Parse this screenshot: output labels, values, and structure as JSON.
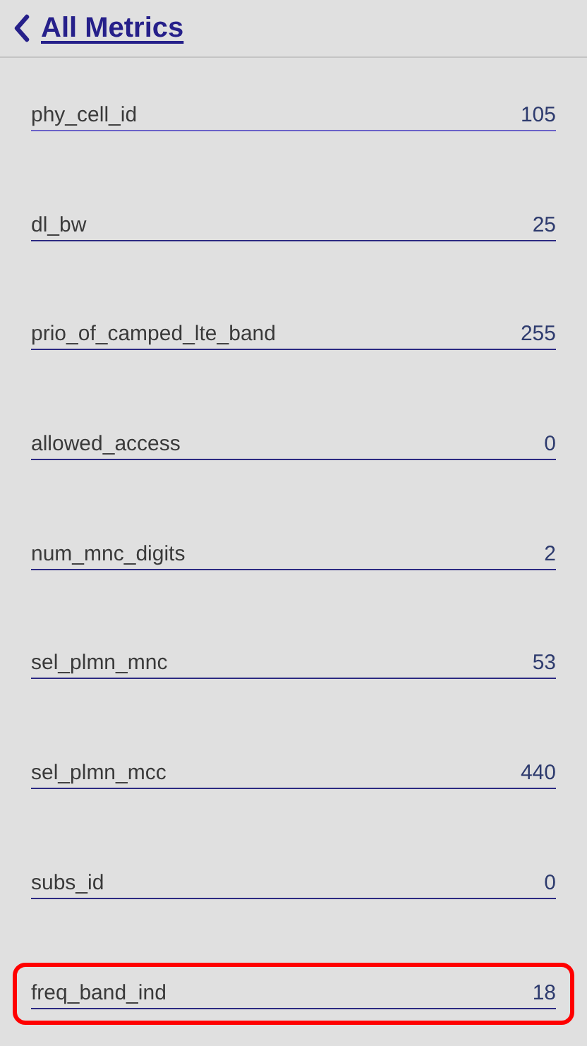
{
  "header": {
    "back_link": "All Metrics"
  },
  "metrics": [
    {
      "name": "phy_cell_id",
      "value": "105",
      "focused": true,
      "highlighted": false
    },
    {
      "name": "dl_bw",
      "value": "25",
      "focused": false,
      "highlighted": false
    },
    {
      "name": "prio_of_camped_lte_band",
      "value": "255",
      "focused": false,
      "highlighted": false
    },
    {
      "name": "allowed_access",
      "value": "0",
      "focused": false,
      "highlighted": false
    },
    {
      "name": "num_mnc_digits",
      "value": "2",
      "focused": false,
      "highlighted": false
    },
    {
      "name": "sel_plmn_mnc",
      "value": "53",
      "focused": false,
      "highlighted": false
    },
    {
      "name": "sel_plmn_mcc",
      "value": "440",
      "focused": false,
      "highlighted": false
    },
    {
      "name": "subs_id",
      "value": "0",
      "focused": false,
      "highlighted": false
    },
    {
      "name": "freq_band_ind",
      "value": "18",
      "focused": false,
      "highlighted": true
    }
  ]
}
